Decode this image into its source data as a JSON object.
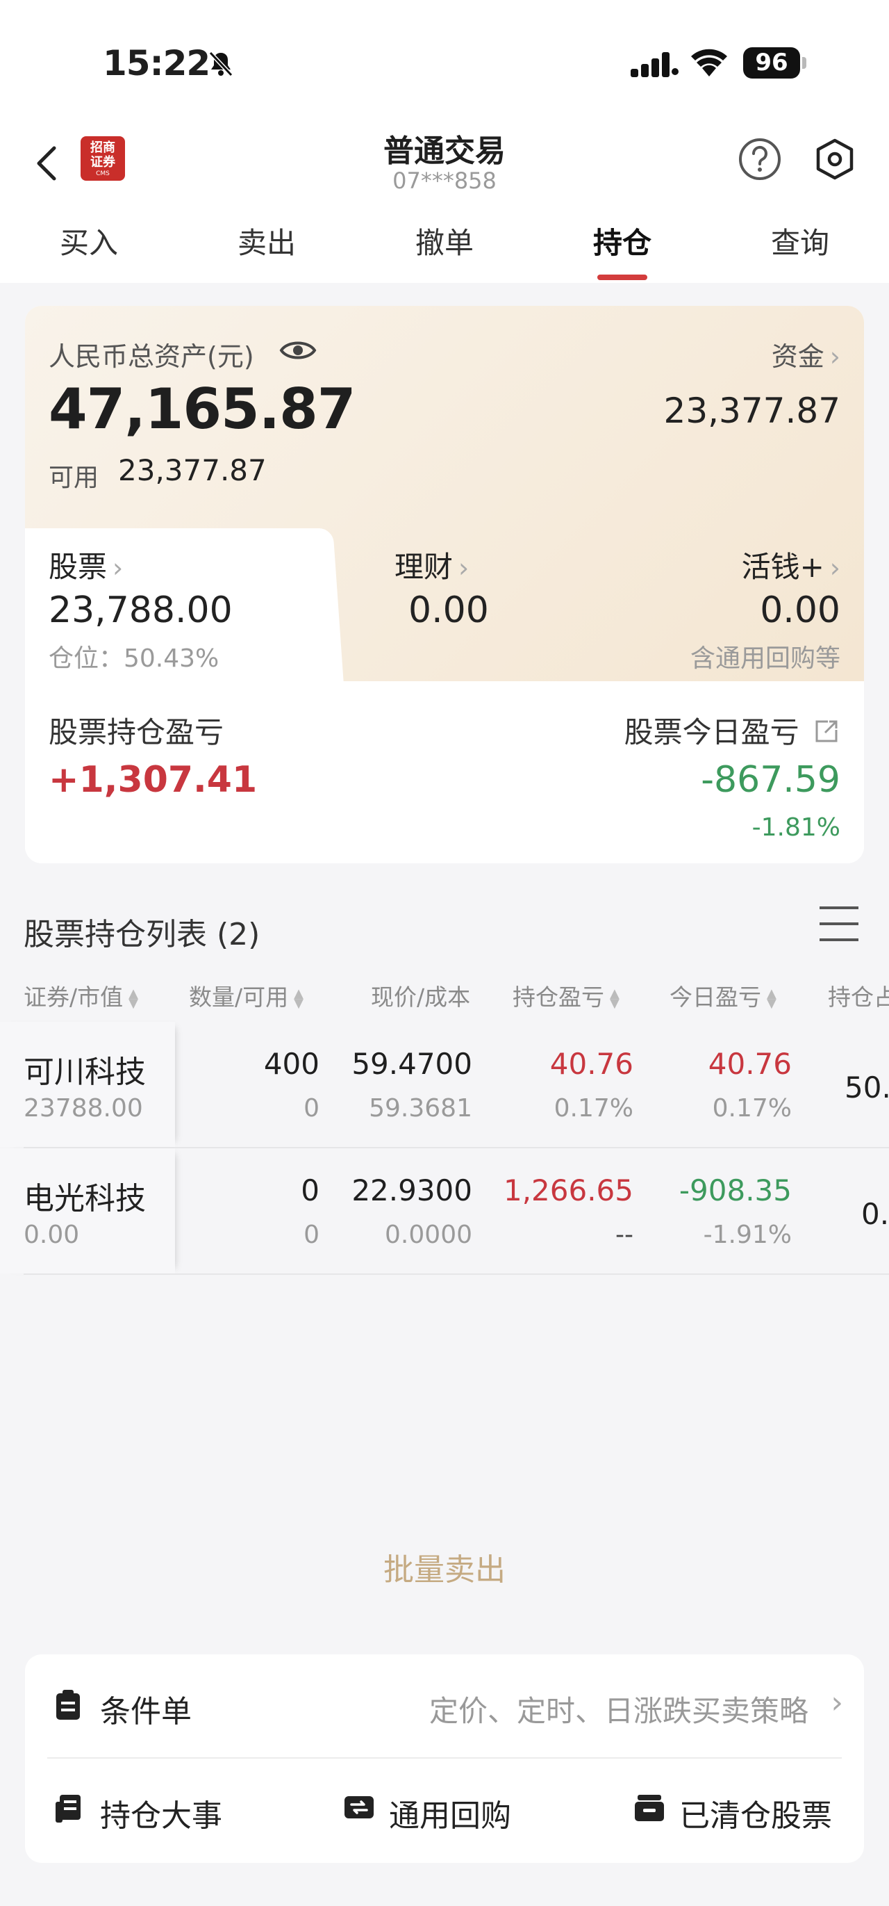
{
  "status_bar": {
    "time": "15:22",
    "battery": "96"
  },
  "header": {
    "title": "普通交易",
    "account": "07***858",
    "logo_line1": "招商",
    "logo_line2": "证券",
    "logo_sub": "CMS"
  },
  "tabs": [
    {
      "label": "买入"
    },
    {
      "label": "卖出"
    },
    {
      "label": "撤单"
    },
    {
      "label": "持仓",
      "active": true
    },
    {
      "label": "查询"
    }
  ],
  "asset": {
    "total_label": "人民币总资产(元)",
    "total_value": "47,165.87",
    "available_label": "可用",
    "available_value": "23,377.87",
    "funds_label": "资金",
    "funds_value": "23,377.87",
    "stock_label": "股票",
    "stock_value": "23,788.00",
    "position_ratio": "仓位：50.43%",
    "wealth_label": "理财",
    "wealth_value": "0.00",
    "cash_label": "活钱+",
    "cash_value": "0.00",
    "cash_note": "含通用回购等",
    "holding_pnl_label": "股票持仓盈亏",
    "holding_pnl_value": "+1,307.41",
    "today_pnl_label": "股票今日盈亏",
    "today_pnl_value": "-867.59",
    "today_pnl_pct": "-1.81%"
  },
  "holdings": {
    "title": "股票持仓列表 (2)",
    "columns": [
      "证券/市值",
      "数量/可用",
      "现价/成本",
      "持仓盈亏",
      "今日盈亏",
      "持仓占"
    ],
    "rows": [
      {
        "name": "可川科技",
        "market_value": "23788.00",
        "qty": "400",
        "avail": "0",
        "price": "59.4700",
        "cost": "59.3681",
        "hold_pnl": "40.76",
        "hold_pnl_pct": "0.17%",
        "today_pnl": "40.76",
        "today_pnl_pct": "0.17%",
        "ratio": "50."
      },
      {
        "name": "电光科技",
        "market_value": "0.00",
        "qty": "0",
        "avail": "0",
        "price": "22.9300",
        "cost": "0.0000",
        "hold_pnl": "1,266.65",
        "hold_pnl_pct": "--",
        "today_pnl": "-908.35",
        "today_pnl_pct": "-1.91%",
        "ratio": "0."
      }
    ]
  },
  "batch_sell": "批量卖出",
  "bottom": {
    "conditional_label": "条件单",
    "conditional_desc": "定价、定时、日涨跌买卖策略",
    "major_events": "持仓大事",
    "general_repo": "通用回购",
    "cleared_stocks": "已清仓股票"
  },
  "colors": {
    "accent": "#d33c3c",
    "profit": "#c8373f",
    "loss": "#3d9a5d",
    "gold": "#c5aa82"
  }
}
